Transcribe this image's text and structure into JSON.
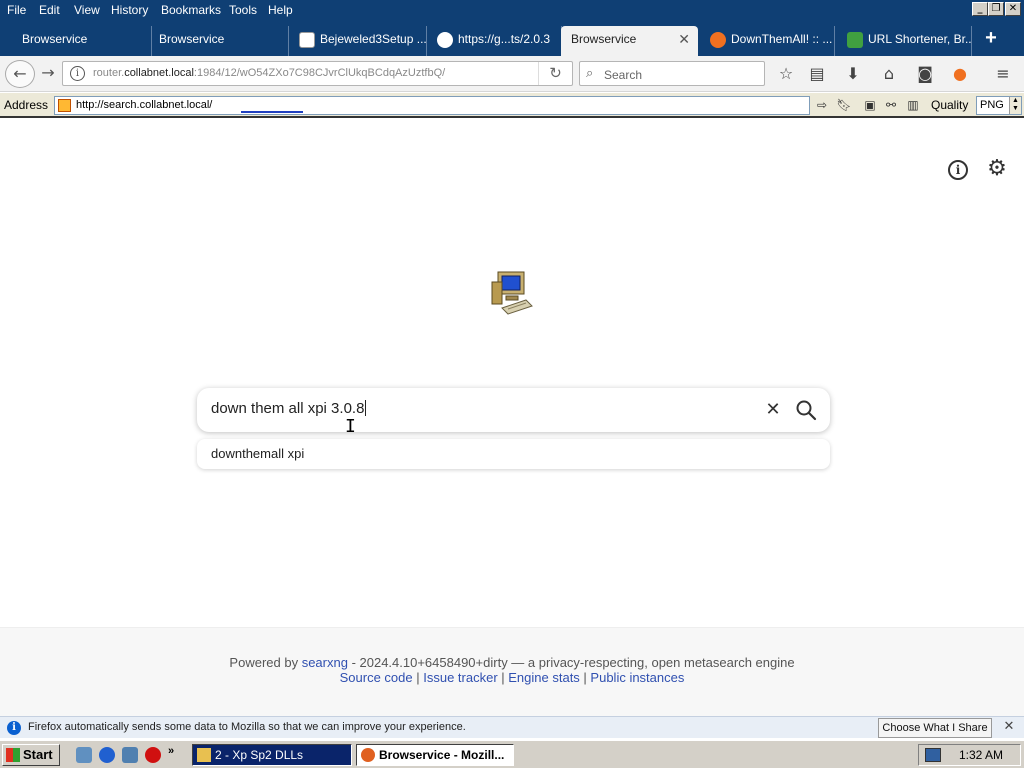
{
  "menubar": {
    "items": [
      "File",
      "Edit",
      "View",
      "History",
      "Bookmarks",
      "Tools",
      "Help"
    ]
  },
  "tabs": [
    {
      "label": "Browservice",
      "active": false
    },
    {
      "label": "Browservice",
      "active": false
    },
    {
      "label": "Bejeweled3Setup ...",
      "active": false
    },
    {
      "label": "https://g...ts/2.0.3",
      "active": false
    },
    {
      "label": "Browservice",
      "active": true
    },
    {
      "label": "DownThemAll! :: ...",
      "active": false
    },
    {
      "label": "URL Shortener, Br...",
      "active": false
    }
  ],
  "navbar": {
    "url_gray_prefix": "router.",
    "url_domain": "collabnet.local",
    "url_rest": ":1984/12/wO54ZXo7C98CJvrClUkqBCdqAzUztfbQ/",
    "search_placeholder": "Search"
  },
  "addressbar": {
    "label": "Address",
    "url": "http://search.collabnet.local/",
    "quality_label": "Quality",
    "quality_value": "PNG"
  },
  "page": {
    "search_query": "down them all xpi 3.0.8",
    "suggestion": "downthemall xpi",
    "footer": {
      "powered_by": "Powered by",
      "engine_link": "searxng",
      "version_text": " - 2024.4.10+6458490+dirty — a privacy-respecting, open metasearch engine",
      "links": [
        "Source code",
        "Issue tracker",
        "Engine stats",
        "Public instances"
      ],
      "separator": " | "
    }
  },
  "notification": {
    "text": "Firefox automatically sends some data to Mozilla so that we can improve your experience.",
    "button": "Choose What I Share"
  },
  "taskbar": {
    "start": "Start",
    "tasks": [
      "2 - Xp Sp2 DLLs",
      "Browservice - Mozill..."
    ],
    "clock": "1:32 AM"
  },
  "colors": {
    "title_bar": "#0f3f74",
    "link": "#3050b0",
    "taskbar": "#d4d0c8"
  }
}
